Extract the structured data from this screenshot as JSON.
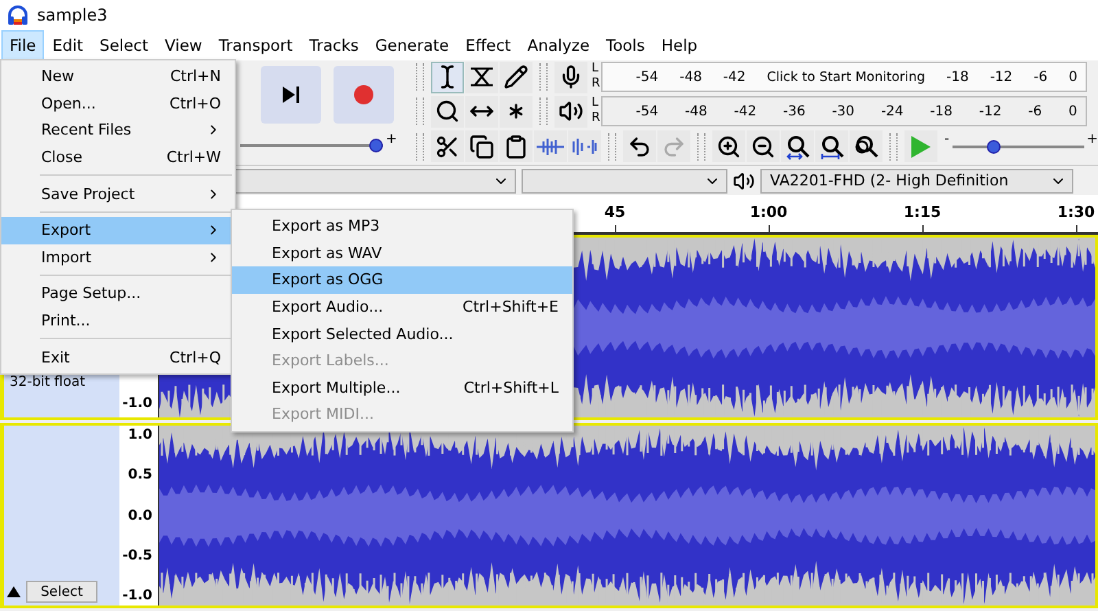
{
  "window": {
    "title": "sample3"
  },
  "menubar": [
    {
      "label": "File",
      "selected": true
    },
    {
      "label": "Edit",
      "selected": false
    },
    {
      "label": "Select",
      "selected": false
    },
    {
      "label": "View",
      "selected": false
    },
    {
      "label": "Transport",
      "selected": false
    },
    {
      "label": "Tracks",
      "selected": false
    },
    {
      "label": "Generate",
      "selected": false
    },
    {
      "label": "Effect",
      "selected": false
    },
    {
      "label": "Analyze",
      "selected": false
    },
    {
      "label": "Tools",
      "selected": false
    },
    {
      "label": "Help",
      "selected": false
    }
  ],
  "file_menu": [
    {
      "kind": "item",
      "label": "New",
      "shortcut": "Ctrl+N",
      "selected": false
    },
    {
      "kind": "item",
      "label": "Open...",
      "shortcut": "Ctrl+O",
      "selected": false
    },
    {
      "kind": "submenu",
      "label": "Recent Files",
      "selected": false
    },
    {
      "kind": "item",
      "label": "Close",
      "shortcut": "Ctrl+W",
      "selected": false
    },
    {
      "kind": "separator"
    },
    {
      "kind": "submenu",
      "label": "Save Project",
      "selected": false
    },
    {
      "kind": "separator"
    },
    {
      "kind": "submenu",
      "label": "Export",
      "selected": true
    },
    {
      "kind": "submenu",
      "label": "Import",
      "selected": false
    },
    {
      "kind": "separator"
    },
    {
      "kind": "item",
      "label": "Page Setup...",
      "selected": false
    },
    {
      "kind": "item",
      "label": "Print...",
      "selected": false
    },
    {
      "kind": "separator"
    },
    {
      "kind": "item",
      "label": "Exit",
      "shortcut": "Ctrl+Q",
      "selected": false
    }
  ],
  "export_menu": [
    {
      "label": "Export as MP3",
      "selected": false,
      "disabled": false
    },
    {
      "label": "Export as WAV",
      "selected": false,
      "disabled": false
    },
    {
      "label": "Export as OGG",
      "selected": true,
      "disabled": false
    },
    {
      "label": "Export Audio...",
      "shortcut": "Ctrl+Shift+E",
      "selected": false,
      "disabled": false
    },
    {
      "label": "Export Selected Audio...",
      "selected": false,
      "disabled": false
    },
    {
      "label": "Export Labels...",
      "selected": false,
      "disabled": true
    },
    {
      "label": "Export Multiple...",
      "shortcut": "Ctrl+Shift+L",
      "selected": false,
      "disabled": false
    },
    {
      "label": "Export MIDI...",
      "selected": false,
      "disabled": true
    }
  ],
  "tools": {
    "selection_selected": true
  },
  "volume_slider": {
    "plus": "+",
    "level": 1
  },
  "meters": [
    {
      "kind": "record",
      "channels": [
        "L",
        "R"
      ],
      "labels": [
        {
          "kind": "tick",
          "text": "-54"
        },
        {
          "kind": "tick",
          "text": "-48"
        },
        {
          "kind": "tick",
          "text": "-42"
        },
        {
          "kind": "message",
          "text": "Click to Start Monitoring"
        },
        {
          "kind": "tick",
          "text": "-18"
        },
        {
          "kind": "tick",
          "text": "-12"
        },
        {
          "kind": "tick",
          "text": "-6"
        },
        {
          "kind": "tick",
          "text": "0"
        }
      ]
    },
    {
      "kind": "playback",
      "channels": [
        "L",
        "R"
      ],
      "labels": [
        {
          "kind": "tick",
          "text": "-54"
        },
        {
          "kind": "tick",
          "text": "-48"
        },
        {
          "kind": "tick",
          "text": "-42"
        },
        {
          "kind": "tick",
          "text": "-36"
        },
        {
          "kind": "tick",
          "text": "-30"
        },
        {
          "kind": "tick",
          "text": "-24"
        },
        {
          "kind": "tick",
          "text": "-18"
        },
        {
          "kind": "tick",
          "text": "-12"
        },
        {
          "kind": "tick",
          "text": "-6"
        },
        {
          "kind": "tick",
          "text": "0"
        }
      ]
    }
  ],
  "play_at_speed": {
    "minus": "-",
    "plus": "+",
    "level": 0.3
  },
  "device_bar": {
    "output_device": "VA2201-FHD (2- High Definition"
  },
  "ruler": {
    "labels": [
      "45",
      "1:00",
      "1:15",
      "1:30"
    ]
  },
  "tracks": [
    {
      "info": "32-bit float",
      "axis": [
        "-1.0"
      ]
    },
    {
      "axis": [
        "1.0",
        "0.5",
        "0.0",
        "-0.5",
        "-1.0"
      ],
      "select_button": "Select"
    }
  ]
}
